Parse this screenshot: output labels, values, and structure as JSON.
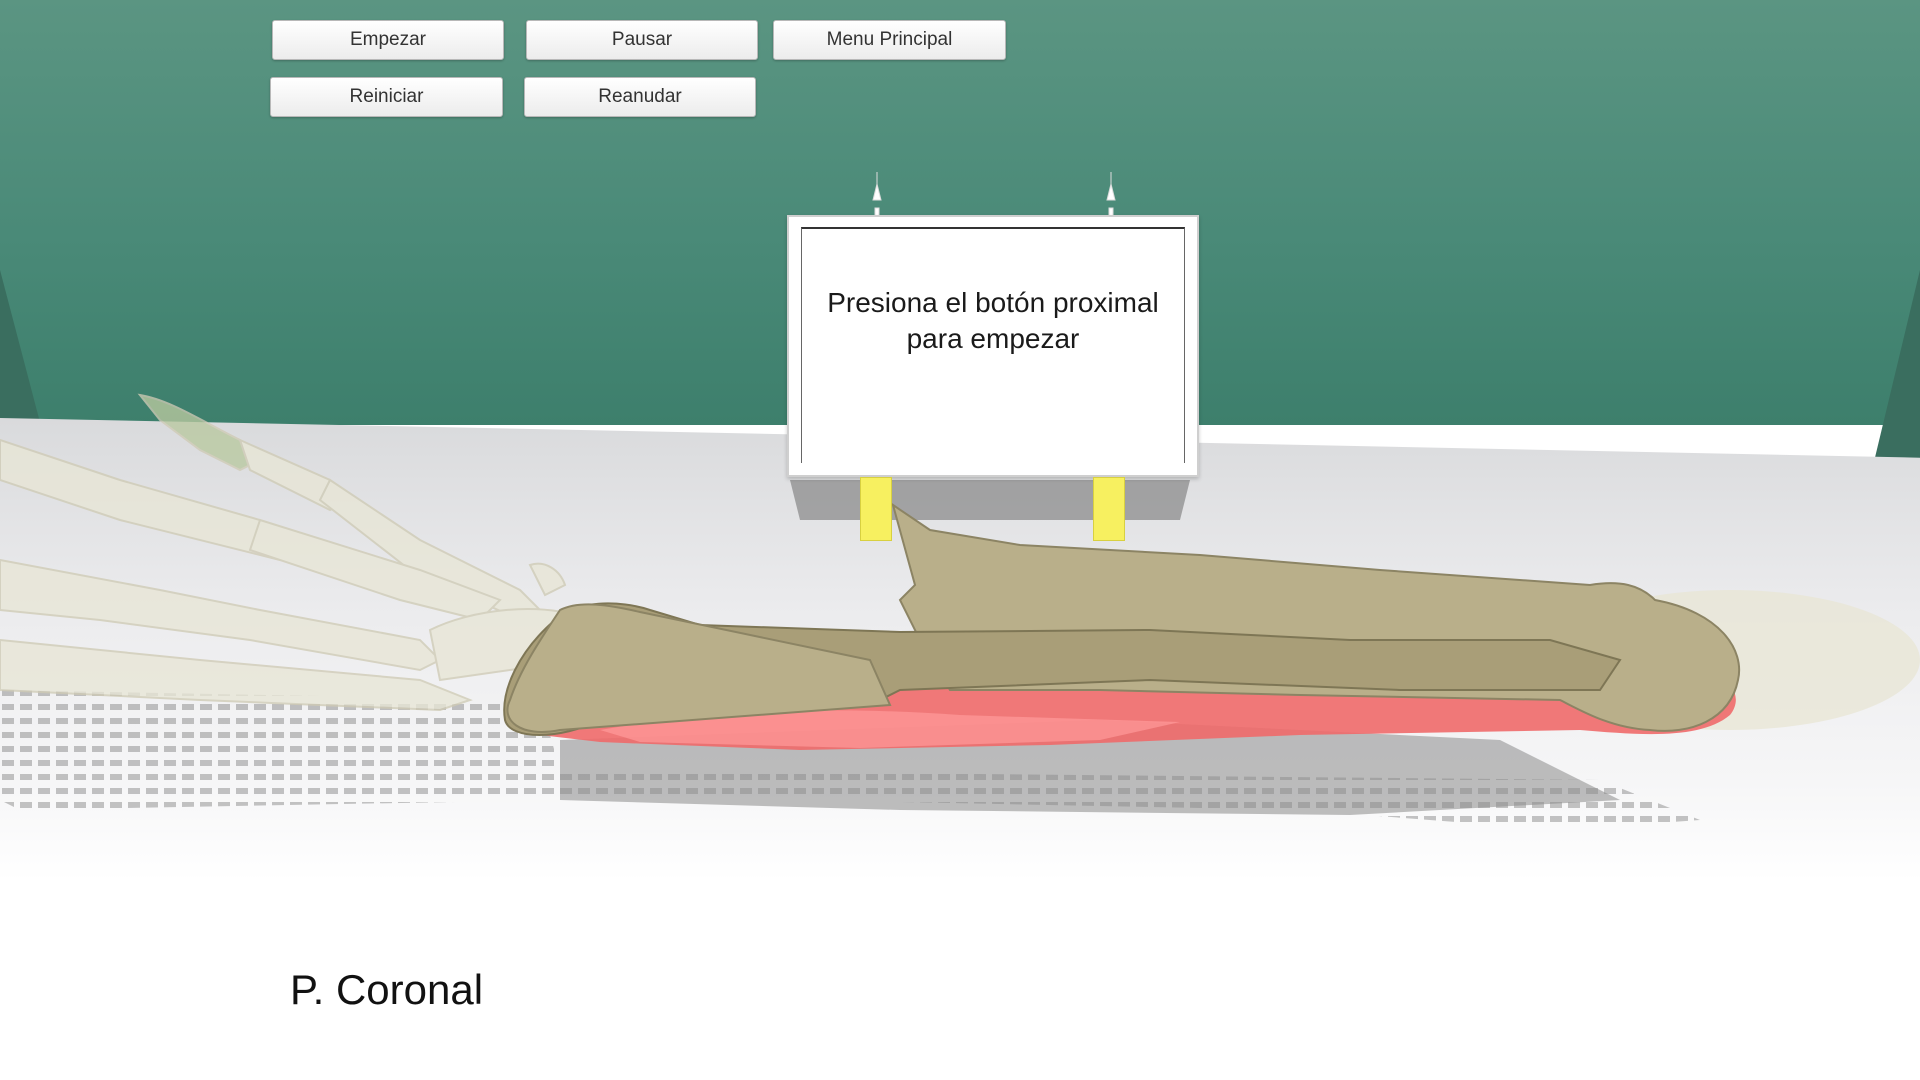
{
  "toolbar": {
    "start_label": "Empezar",
    "pause_label": "Pausar",
    "main_menu_label": "Menu Principal",
    "restart_label": "Reiniciar",
    "resume_label": "Reanudar"
  },
  "board": {
    "message": "Presiona el botón proximal\npara empezar"
  },
  "plane": {
    "label": "P. Coronal"
  },
  "colors": {
    "wall": "#4a8a78",
    "bone": "#b9af8a",
    "muscle": "#f06a6a",
    "board_legs": "#f7f060"
  }
}
